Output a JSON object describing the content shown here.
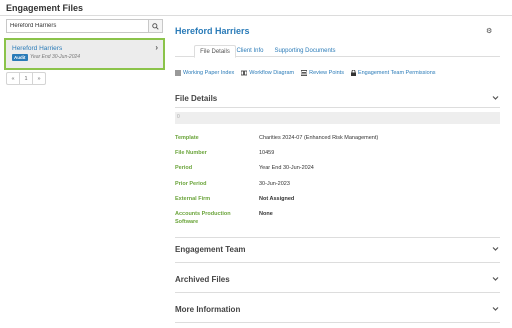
{
  "page": {
    "title": "Engagement Files"
  },
  "search": {
    "value": "Hereford Harriers"
  },
  "results": [
    {
      "name": "Hereford Harriers",
      "badge": "Audit",
      "period": "Year End 30-Jun-2024"
    }
  ],
  "pager": {
    "prev": "«",
    "current": "1",
    "next": "»"
  },
  "engagement": {
    "name": "Hereford Harriers",
    "tabs": [
      {
        "label": "File Details",
        "active": true
      },
      {
        "label": "Client Info",
        "active": false
      },
      {
        "label": "Supporting Documents",
        "active": false
      }
    ],
    "links": [
      {
        "label": "Working Paper Index",
        "icon": "list-icon"
      },
      {
        "label": "Workflow Diagram",
        "icon": "workflow-icon"
      },
      {
        "label": "Review Points",
        "icon": "review-points-icon"
      },
      {
        "label": "Engagement Team Permissions",
        "icon": "lock-icon"
      }
    ]
  },
  "file_details": {
    "title": "File Details",
    "note": "0",
    "fields": [
      {
        "label": "Template",
        "value": "Charities 2024-07 (Enhanced Risk Management)"
      },
      {
        "label": "File Number",
        "value": "10459"
      },
      {
        "label": "Period",
        "value": "Year End 30-Jun-2024"
      },
      {
        "label": "Prior Period",
        "value": "30-Jun-2023"
      },
      {
        "label": "External Firm",
        "value": "Not Assigned"
      },
      {
        "label": "Accounts Production Software",
        "value": "None"
      }
    ]
  },
  "sections": {
    "team": "Engagement Team",
    "archived": "Archived Files",
    "more": "More Information"
  },
  "colors": {
    "link": "#2a7bb8",
    "label_green": "#6aa43a",
    "selected_border": "#8bc34a"
  }
}
